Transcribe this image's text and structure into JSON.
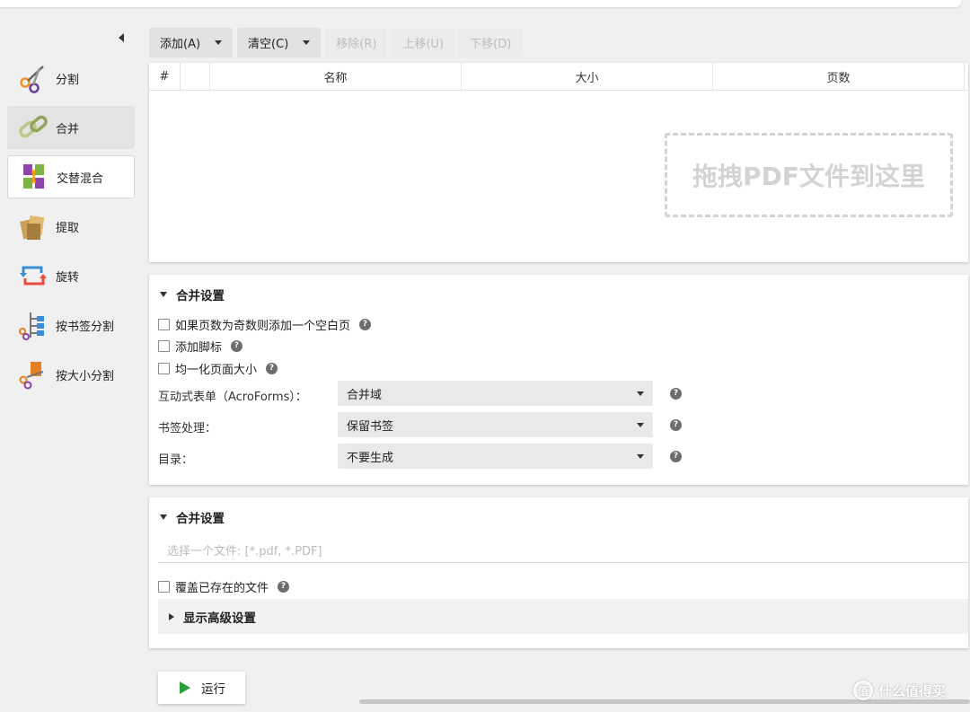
{
  "sidebar": {
    "items": [
      {
        "label": "分割",
        "icon": "scissors-icon"
      },
      {
        "label": "合并",
        "icon": "chain-link-icon"
      },
      {
        "label": "交替混合",
        "icon": "alternate-mix-icon"
      },
      {
        "label": "提取",
        "icon": "extract-pages-icon"
      },
      {
        "label": "旋转",
        "icon": "rotate-icon"
      },
      {
        "label": "按书签分割",
        "icon": "bookmark-split-icon"
      },
      {
        "label": "按大小分割",
        "icon": "size-split-icon"
      }
    ]
  },
  "toolbar": {
    "add": "添加(A)",
    "clear": "清空(C)",
    "remove": "移除(R)",
    "move_up": "上移(U)",
    "move_down": "下移(D)"
  },
  "table": {
    "columns": [
      "#",
      "",
      "名称",
      "大小",
      "页数"
    ],
    "drop_hint": "拖拽PDF文件到这里"
  },
  "merge_settings": {
    "title": "合并设置",
    "checkboxes": [
      "如果页数为奇数则添加一个空白页",
      "添加脚标",
      "均一化页面大小"
    ],
    "fields": [
      {
        "label": "互动式表单（AcroForms）：",
        "value": "合并域"
      },
      {
        "label": "书签处理：",
        "value": "保留书签"
      },
      {
        "label": "目录：",
        "value": "不要生成"
      }
    ]
  },
  "output_settings": {
    "title": "合并设置",
    "file_placeholder": "选择一个文件: [*.pdf, *.PDF]",
    "overwrite_label": "覆盖已存在的文件",
    "advanced_label": "显示高级设置"
  },
  "run": {
    "label": "运行"
  },
  "watermark": {
    "badge": "值",
    "text": "什么值得买"
  },
  "help_glyph": "?",
  "colors": {
    "run_green": "#27a03c"
  }
}
